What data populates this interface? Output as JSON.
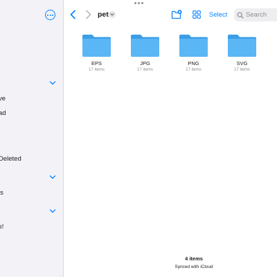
{
  "toolbar": {
    "folder_title": "pet",
    "select_label": "Select",
    "search_placeholder": "Search",
    "accent_color": "#0a84ff"
  },
  "sidebar": {
    "items": [
      {
        "label": "ve"
      },
      {
        "label": "ad"
      },
      {
        "label": "Deleted"
      },
      {
        "label": "ls"
      },
      {
        "label": "s!"
      }
    ]
  },
  "folders": [
    {
      "name": "EPS",
      "count": "17 items"
    },
    {
      "name": "JPG",
      "count": "17 items"
    },
    {
      "name": "PNG",
      "count": "17 items"
    },
    {
      "name": "SVG",
      "count": "17 items"
    }
  ],
  "footer": {
    "items_count": "4 items",
    "sync_status": "Synced with iCloud"
  },
  "icons": {
    "more": "ellipsis-circle-icon",
    "back": "chevron-left-icon",
    "forward": "chevron-right-icon",
    "new_folder": "folder-badge-plus-icon",
    "view": "grid-icon",
    "search": "magnifying-glass-icon",
    "folder": "folder-icon"
  }
}
